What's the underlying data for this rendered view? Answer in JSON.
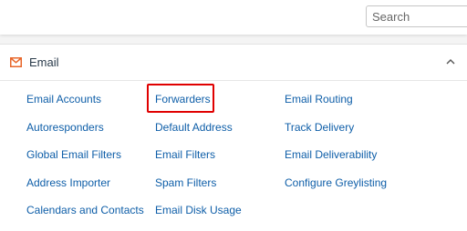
{
  "search": {
    "placeholder": "Search"
  },
  "email_section": {
    "title": "Email",
    "icon": "mail-icon",
    "collapse_icon": "chevron-up-icon",
    "accent_color": "#e8662a",
    "link_color": "#0e5ea8",
    "highlight_color": "#e00000",
    "highlighted_item": "Forwarders",
    "columns": [
      [
        "Email Accounts",
        "Autoresponders",
        "Global Email Filters",
        "Address Importer",
        "Calendars and Contacts"
      ],
      [
        "Forwarders",
        "Default Address",
        "Email Filters",
        "Spam Filters",
        "Email Disk Usage"
      ],
      [
        "Email Routing",
        "Track Delivery",
        "Email Deliverability",
        "Configure Greylisting"
      ]
    ]
  }
}
